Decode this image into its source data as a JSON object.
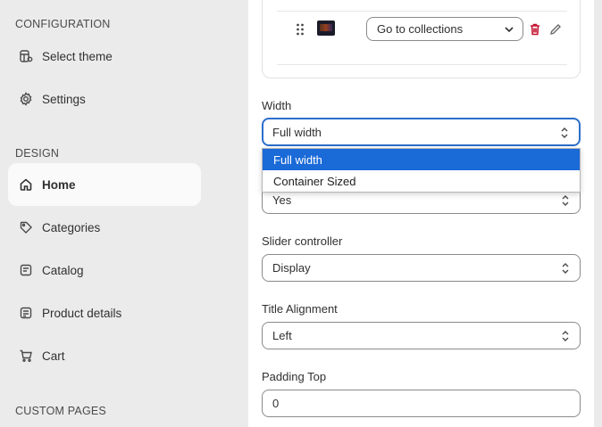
{
  "sidebar": {
    "sections": [
      {
        "title": "CONFIGURATION"
      },
      {
        "title": "DESIGN"
      },
      {
        "title": "CUSTOM PAGES"
      }
    ],
    "items": [
      {
        "label": "Select theme",
        "icon": "theme-icon"
      },
      {
        "label": "Settings",
        "icon": "gear-icon"
      },
      {
        "label": "Home",
        "icon": "home-icon",
        "active": true
      },
      {
        "label": "Categories",
        "icon": "tag-icon"
      },
      {
        "label": "Catalog",
        "icon": "catalog-icon"
      },
      {
        "label": "Product details",
        "icon": "product-details-icon"
      },
      {
        "label": "Cart",
        "icon": "cart-icon"
      }
    ]
  },
  "link_row": {
    "select_value": "Go to collections"
  },
  "fields": {
    "width": {
      "label": "Width",
      "value": "Full width",
      "options": [
        "Full width",
        "Container Sized"
      ]
    },
    "hidden_select": {
      "value": "Yes"
    },
    "slider_controller": {
      "label": "Slider controller",
      "value": "Display"
    },
    "title_alignment": {
      "label": "Title Alignment",
      "value": "Left"
    },
    "padding_top": {
      "label": "Padding Top",
      "value": "0"
    }
  },
  "colors": {
    "accent": "#2c6ecb",
    "selected_option": "#1a6ad8",
    "trash": "#c4122f",
    "sidebar_bg": "#ebebeb"
  }
}
